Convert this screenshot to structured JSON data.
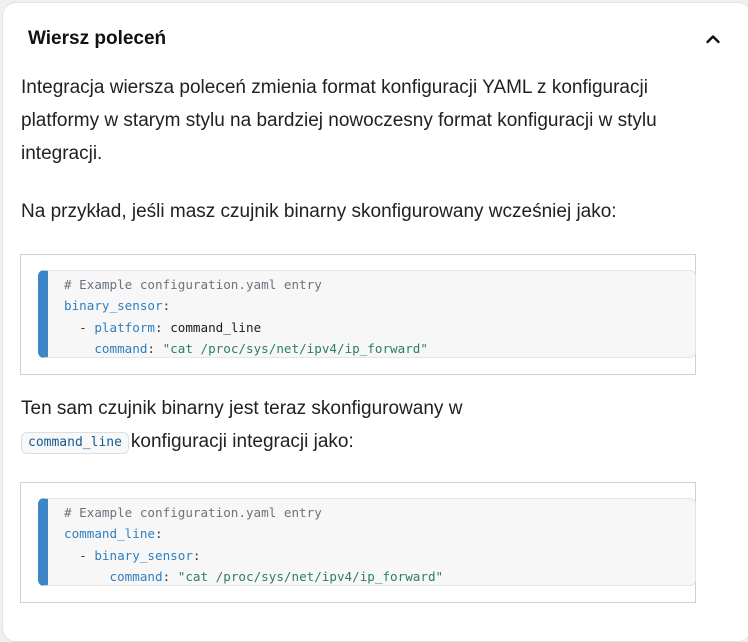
{
  "section": {
    "title": "Wiersz poleceń",
    "chevron_icon": "chevron-up-icon",
    "expanded": true
  },
  "paragraphs": {
    "intro": "Integracja wiersza poleceń zmienia format konfiguracji YAML z konfiguracji platformy w starym stylu na bardziej nowoczesny format konfiguracji w stylu integracji.",
    "example_lead": "Na przykład, jeśli masz czujnik binarny skonfigurowany wcześniej jako:",
    "now_prefix": "Ten sam czujnik binarny jest teraz skonfigurowany w ",
    "now_code": "command_line",
    "now_suffix": "konfiguracji integracji jako:"
  },
  "code_blocks": {
    "old": {
      "comment": "# Example configuration.yaml entry",
      "root_key": "binary_sensor",
      "item_dash": "  - ",
      "item_key": "platform",
      "item_value": "command_line",
      "indent": "    ",
      "cmd_key": "command",
      "cmd_value": "\"cat /proc/sys/net/ipv4/ip_forward\""
    },
    "new": {
      "comment": "# Example configuration.yaml entry",
      "root_key": "command_line",
      "item_dash": "  - ",
      "item_key": "binary_sensor",
      "indent": "      ",
      "cmd_key": "command",
      "cmd_value": "\"cat /proc/sys/net/ipv4/ip_forward\""
    },
    "colon": ":",
    "colon_space": ": "
  },
  "colors": {
    "accent_bar": "#3f86c7",
    "code_key": "#2f7fbf",
    "code_string": "#2c7d6a",
    "code_comment": "#6a737d"
  }
}
